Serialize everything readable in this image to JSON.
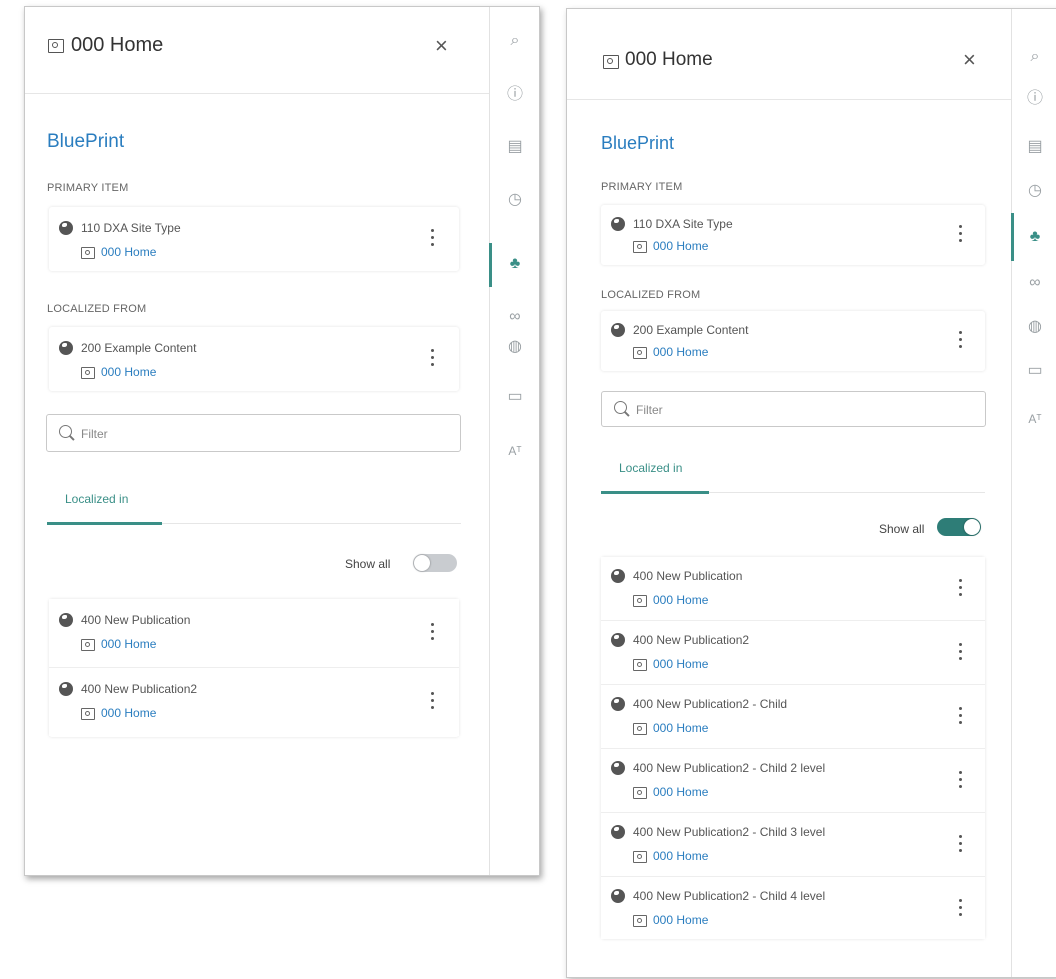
{
  "left_panel": {
    "title": "000 Home",
    "close_label": "×",
    "section_title": "BluePrint",
    "primary_label": "PRIMARY ITEM",
    "primary": {
      "publication": "110 DXA Site Type",
      "page": "000 Home"
    },
    "localized_from_label": "LOCALIZED FROM",
    "localized_from": {
      "publication": "200 Example Content",
      "page": "000 Home"
    },
    "filter_placeholder": "Filter",
    "tab_label": "Localized in",
    "show_all_label": "Show all",
    "show_all_state": "off",
    "items": [
      {
        "publication": "400 New Publication",
        "page": "000 Home"
      },
      {
        "publication": "400 New Publication2",
        "page": "000 Home"
      }
    ]
  },
  "right_panel": {
    "title": "000 Home",
    "close_label": "×",
    "section_title": "BluePrint",
    "primary_label": "PRIMARY ITEM",
    "primary": {
      "publication": "110 DXA Site Type",
      "page": "000 Home"
    },
    "localized_from_label": "LOCALIZED FROM",
    "localized_from": {
      "publication": "200 Example Content",
      "page": "000 Home"
    },
    "filter_placeholder": "Filter",
    "tab_label": "Localized in",
    "show_all_label": "Show all",
    "show_all_state": "on",
    "items": [
      {
        "publication": "400 New Publication",
        "page": "000 Home"
      },
      {
        "publication": "400 New Publication2",
        "page": "000 Home"
      },
      {
        "publication": "400 New Publication2 - Child",
        "page": "000 Home"
      },
      {
        "publication": "400 New Publication2 - Child 2 level",
        "page": "000 Home"
      },
      {
        "publication": "400 New Publication2 - Child 3 level",
        "page": "000 Home"
      },
      {
        "publication": "400 New Publication2 - Child 4 level",
        "page": "000 Home"
      }
    ]
  },
  "rail_icons": [
    "search-icon",
    "info-icon",
    "document-icon",
    "history-icon",
    "blueprint-icon",
    "glasses-icon",
    "publish-icon",
    "window-icon",
    "translate-icon"
  ],
  "rail_glyphs": [
    "⌕",
    "ⓘ",
    "▤",
    "◷",
    "♣",
    "∞",
    "◍",
    "▭",
    "Aᵀ"
  ],
  "active_rail_icon": "blueprint-icon",
  "colors": {
    "accent": "#3a8f87",
    "link": "#2a7dbf",
    "toggle_off": "#c9ccd0",
    "toggle_on": "#2e7d77"
  }
}
